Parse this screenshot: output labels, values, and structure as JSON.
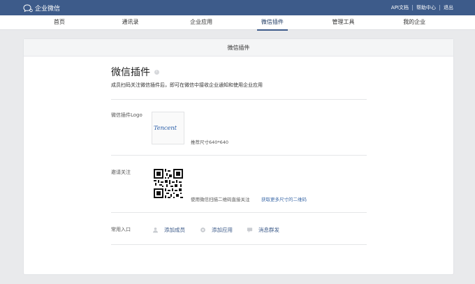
{
  "topbar": {
    "app_name": "企业微信",
    "links": [
      "API文档",
      "帮助中心",
      "退出"
    ]
  },
  "nav": {
    "items": [
      "首页",
      "通讯录",
      "企业应用",
      "微信插件",
      "管理工具",
      "我的企业"
    ],
    "active": "微信插件"
  },
  "card": {
    "header": "微信插件",
    "title": "微信插件",
    "subtitle": "成员扫码关注微信插件后，即可在微信中接收企业通知和使用企业应用",
    "logo_row": {
      "label": "微信插件Logo",
      "logo_text": "Tencent",
      "hint": "推荐尺寸640*640"
    },
    "invite_row": {
      "label": "邀请关注",
      "hint": "使用微信扫描二维码直接关注",
      "link": "获取更多尺寸的二维码"
    },
    "shortcuts_row": {
      "label": "常用入口",
      "items": [
        {
          "icon": "user-icon",
          "label": "添加成员"
        },
        {
          "icon": "app-icon",
          "label": "添加应用"
        },
        {
          "icon": "message-icon",
          "label": "消息群发"
        }
      ]
    }
  },
  "colors": {
    "topbar": "#3d5b8a",
    "link": "#3d6aa8",
    "background": "#e9eaec"
  }
}
